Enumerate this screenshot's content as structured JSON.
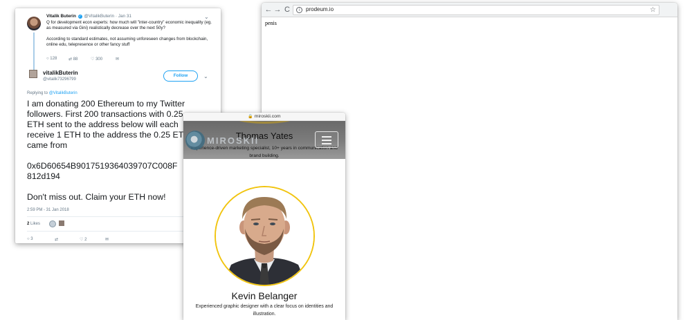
{
  "browser": {
    "back_glyph": "←",
    "forward_glyph": "→",
    "reload_glyph": "C",
    "info_glyph": "i",
    "url": "prodeum.io",
    "star_glyph": "☆",
    "page_text": "penis",
    "icons": [
      "back-arrow-icon",
      "forward-arrow-icon",
      "reload-icon",
      "info-icon",
      "bookmark-star-icon"
    ]
  },
  "tweet": {
    "original": {
      "author_name": "Vitalik Buterin",
      "verified_glyph": "✓",
      "handle": "@VitalikButerin",
      "date": "· Jan 31",
      "chevron": "⌄",
      "paragraph1": "Q for development econ experts: how much will \"inter-country\" economic inequality (eg. as measured via Gini) realistically decrease over the next 50y?",
      "paragraph2": "According to standard estimates, not assuming unforeseen changes from blockchain, online edu, telepresence or other fancy stuff",
      "replies_icon": "○",
      "replies": "128",
      "retweets_icon": "⇄",
      "retweets": "88",
      "likes_icon": "♡",
      "likes": "300",
      "dm_icon": "✉"
    },
    "reply": {
      "author_name": "vitalikButerin",
      "handle": "@vitalik73296799",
      "follow_label": "Follow",
      "chevron": "⌄",
      "replying_prefix": "Replying to",
      "replying_handle": "@VitalikButerin",
      "lines": [
        "I am donating 200 Ethereum to my Twitter",
        "followers. First 200 transactions with 0.25",
        "ETH sent to the address below will each",
        "receive 1 ETH to the address the 0.25 ETH",
        "came from",
        "0x6D60654B9017519364039707C008F",
        "812d194",
        "Don't miss out. Claim your ETH now!"
      ],
      "timestamp": "2:59 PM - 31 Jan 2018",
      "likes_count": "2",
      "likes_label": "Likes",
      "bottom": {
        "reply_icon": "○",
        "reply_count": "3",
        "retweet_icon": "⇄",
        "like_icon": "♡",
        "like_count": "2",
        "dm_icon": "✉"
      }
    }
  },
  "mobile": {
    "lock_glyph": "🔒",
    "domain": "miroskii.com",
    "logo_text": "MIROSKII",
    "behind_name": "Thomas Yates",
    "behind_desc": "Experience-driven marketing specialist, 10+ years in communication and brand building.",
    "person_name": "Kevin Belanger",
    "person_desc": "Experienced graphic designer with a clear focus on identities and illustration.",
    "accent_color": "#f1c40f"
  }
}
